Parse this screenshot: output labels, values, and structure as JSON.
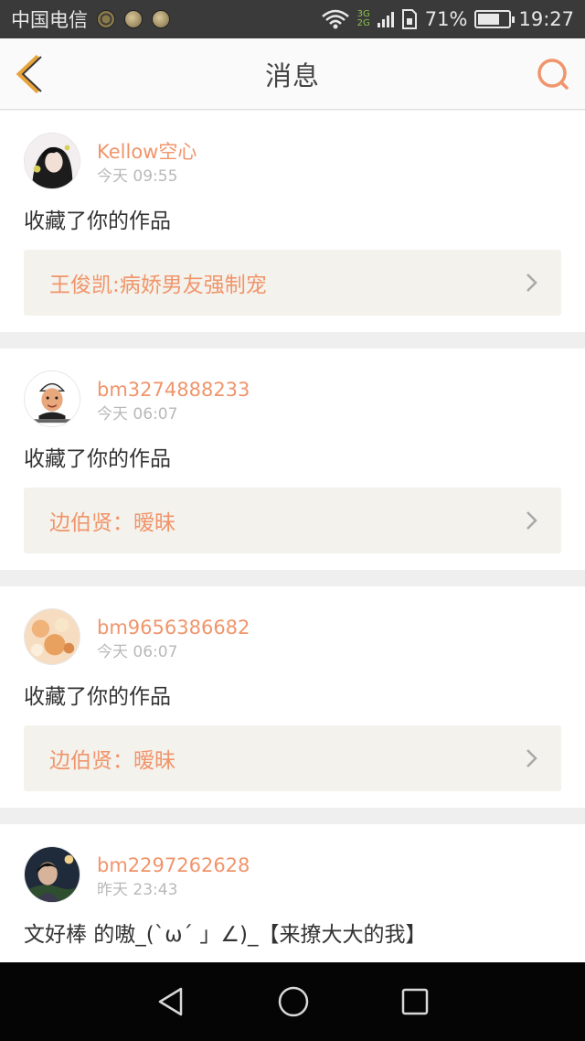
{
  "status_bar": {
    "carrier": "中国电信",
    "network_top": "3G",
    "network_bottom": "2G",
    "battery_percent": "71%",
    "battery_level": 0.71,
    "time": "19:27"
  },
  "navbar": {
    "title": "消息",
    "back_icon": "chevron-left-icon",
    "search_icon": "search-icon",
    "accent_color": "#f0956b"
  },
  "messages": [
    {
      "username": "Kellow空心",
      "time": "今天 09:55",
      "action": "收藏了你的作品",
      "work_title": "王俊凯:病娇男友强制宠"
    },
    {
      "username": "bm3274888233",
      "time": "今天 06:07",
      "action": "收藏了你的作品",
      "work_title": "边伯贤：暧昧"
    },
    {
      "username": "bm9656386682",
      "time": "今天 06:07",
      "action": "收藏了你的作品",
      "work_title": "边伯贤：暧昧"
    },
    {
      "username": "bm2297262628",
      "time": "昨天 23:43",
      "comment": "文好棒 的嗷_(`ω´ 」∠)_【来撩大大的我】"
    }
  ],
  "system_nav": {
    "back_icon": "triangle-back-icon",
    "home_icon": "circle-home-icon",
    "recents_icon": "square-recents-icon"
  }
}
